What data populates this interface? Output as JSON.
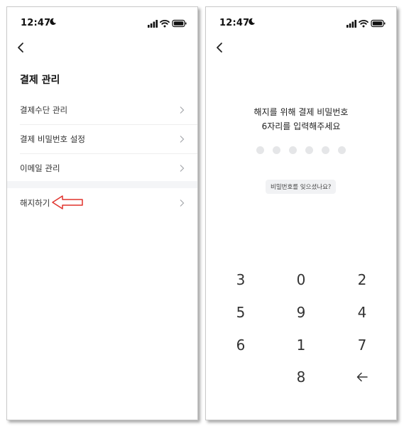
{
  "left_screen": {
    "status": {
      "time": "12:47"
    },
    "title": "결제 관리",
    "menu_items": [
      {
        "label": "결제수단 관리"
      },
      {
        "label": "결제 비밀번호 설정"
      },
      {
        "label": "이메일 관리"
      }
    ],
    "cancel_item": {
      "label": "해지하기"
    },
    "annotation": {
      "arrow_color": "#e0322c"
    }
  },
  "right_screen": {
    "status": {
      "time": "12:47"
    },
    "prompt_line1": "해지를 위해 결제 비밀번호",
    "prompt_line2": "6자리를 입력해주세요",
    "pin_dots": 6,
    "pin_entered": 0,
    "forgot_password": "비밀번호를 잊으셨나요?",
    "keypad": [
      [
        "3",
        "0",
        "2"
      ],
      [
        "5",
        "9",
        "4"
      ],
      [
        "6",
        "1",
        "7"
      ],
      [
        "",
        "8",
        "←"
      ]
    ]
  }
}
